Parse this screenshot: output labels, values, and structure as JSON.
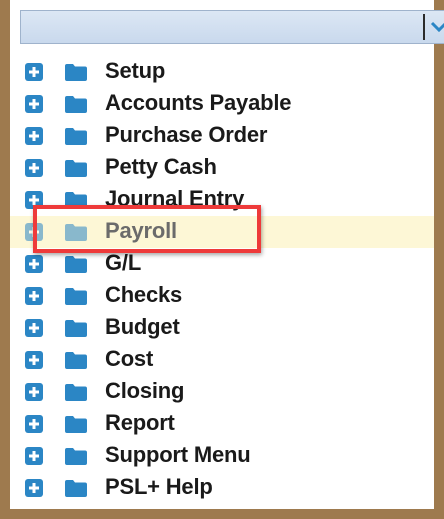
{
  "dropdown": {
    "value": "",
    "icon": "chevron-down-icon",
    "arrow_color": "#2b86c5"
  },
  "menu": {
    "items": [
      {
        "label": "Setup",
        "selected": false
      },
      {
        "label": "Accounts Payable",
        "selected": false
      },
      {
        "label": "Purchase Order",
        "selected": false
      },
      {
        "label": "Petty Cash",
        "selected": false
      },
      {
        "label": "Journal Entry",
        "selected": false
      },
      {
        "label": "Payroll",
        "selected": true
      },
      {
        "label": "G/L",
        "selected": false
      },
      {
        "label": "Checks",
        "selected": false
      },
      {
        "label": "Budget",
        "selected": false
      },
      {
        "label": "Cost",
        "selected": false
      },
      {
        "label": "Closing",
        "selected": false
      },
      {
        "label": "Report",
        "selected": false
      },
      {
        "label": "Support Menu",
        "selected": false
      },
      {
        "label": "PSL+ Help",
        "selected": false
      }
    ],
    "expand_icon": "plus-icon",
    "folder_icon": "folder-icon"
  },
  "colors": {
    "frame": "#9e7a4e",
    "icon_blue": "#2b86c5",
    "selected_background": "#fdf7d6",
    "annotation_red": "#ee3a3a"
  }
}
